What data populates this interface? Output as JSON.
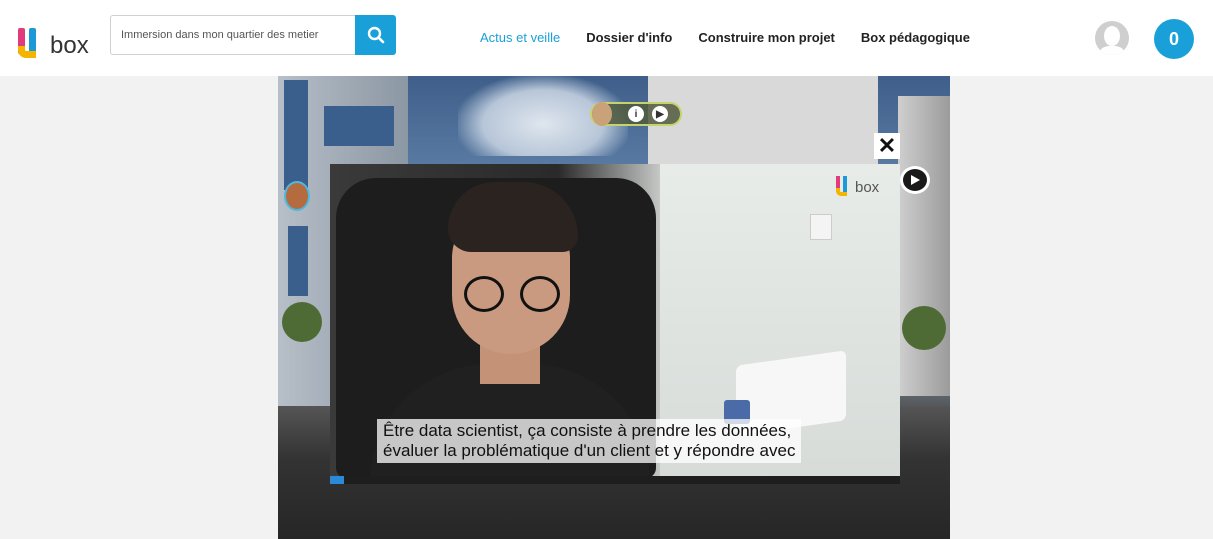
{
  "header": {
    "logo_text": "box",
    "search": {
      "value": "Immersion dans mon quartier des metier",
      "placeholder": ""
    },
    "nav": [
      {
        "label": "Actus et veille",
        "active": true
      },
      {
        "label": "Dossier d'info",
        "active": false
      },
      {
        "label": "Construire mon projet",
        "active": false
      },
      {
        "label": "Box pédagogique",
        "active": false
      }
    ],
    "cart_count": "0"
  },
  "colors": {
    "accent": "#1aa0d8",
    "logo_pink": "#e23b7c",
    "logo_yellow": "#f4b400"
  },
  "video": {
    "logo_text": "box",
    "subtitle_line1": "Être data scientist, ça consiste à prendre les données,",
    "subtitle_line2": "évaluer la problématique d'un client et y répondre avec",
    "progress": 0.025
  },
  "icons": {
    "search": "search-icon",
    "close": "close-icon",
    "play": "play-icon",
    "info": "info-icon",
    "user": "user-avatar-icon"
  }
}
